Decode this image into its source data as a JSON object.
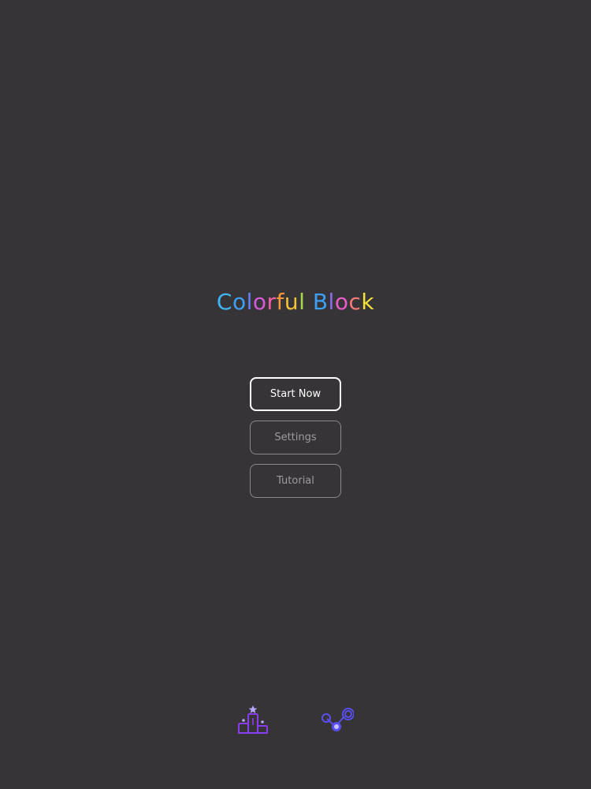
{
  "title": {
    "letters": [
      {
        "char": "C",
        "color": "#3fb6f2"
      },
      {
        "char": "o",
        "color": "#3f9ff2"
      },
      {
        "char": "l",
        "color": "#6a7ef5"
      },
      {
        "char": "o",
        "color": "#d35bd8"
      },
      {
        "char": "r",
        "color": "#f25fa8"
      },
      {
        "char": "f",
        "color": "#f59a3a"
      },
      {
        "char": "u",
        "color": "#f5c33a"
      },
      {
        "char": "l",
        "color": "#a8d84a"
      },
      {
        "char": " ",
        "color": "#ffffff"
      },
      {
        "char": "B",
        "color": "#3f9ff2"
      },
      {
        "char": "l",
        "color": "#8d6cf0"
      },
      {
        "char": "o",
        "color": "#e65cc8"
      },
      {
        "char": "c",
        "color": "#f57a7a"
      },
      {
        "char": "k",
        "color": "#f2e23a"
      }
    ]
  },
  "menu": {
    "start_label": "Start Now",
    "settings_label": "Settings",
    "tutorial_label": "Tutorial"
  },
  "bottom_bar": {
    "leaderboard_icon": "podium-icon",
    "share_icon": "share-icon"
  },
  "colors": {
    "background": "#363436",
    "primary_button_border": "#ffffff",
    "secondary_button_border": "#8a888a",
    "podium": "#8a3cf0",
    "share": "#5a4ef0"
  }
}
